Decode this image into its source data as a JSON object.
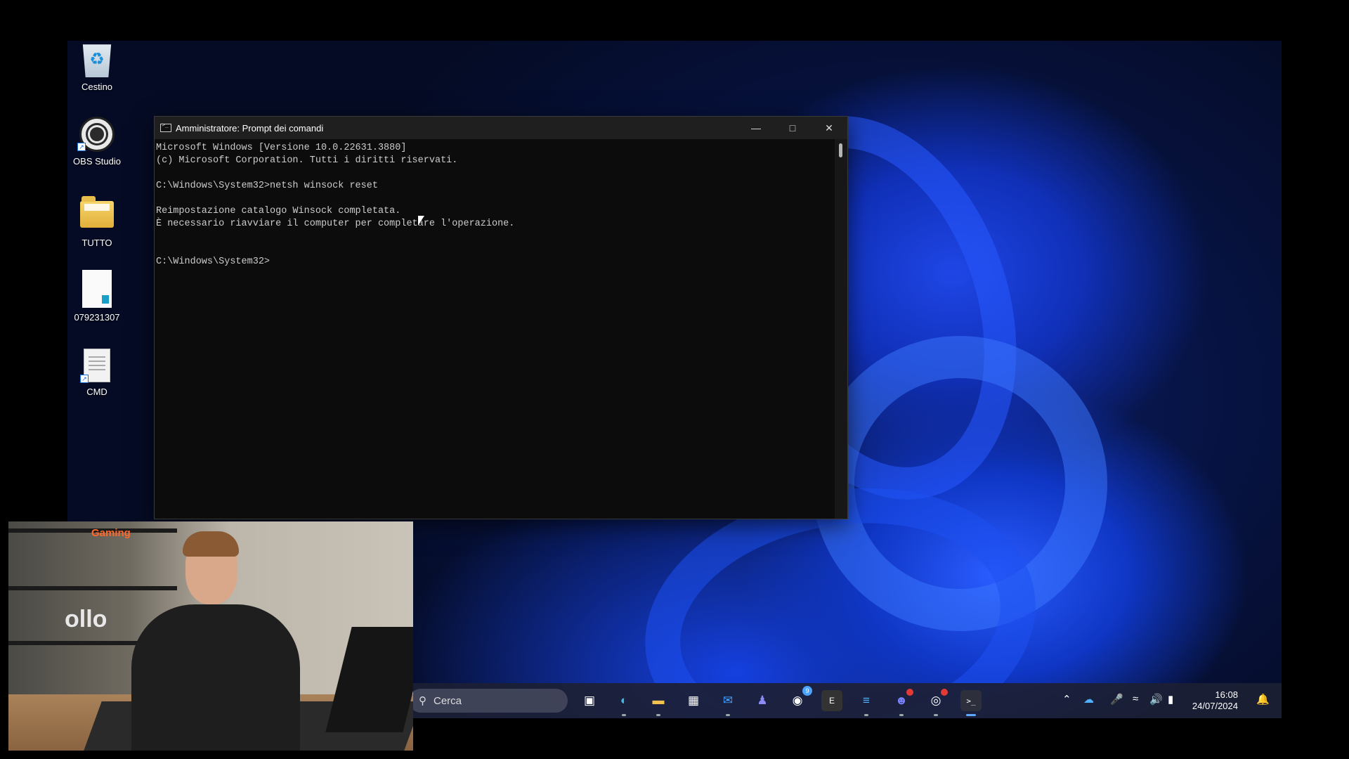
{
  "desktop": {
    "icons": [
      {
        "label": "Cestino",
        "icon": "recycle-bin-icon"
      },
      {
        "label": "OBS Studio",
        "icon": "obs-studio-icon"
      },
      {
        "label": "TUTTO",
        "icon": "folder-icon"
      },
      {
        "label": "079231307",
        "icon": "document-icon"
      },
      {
        "label": "CMD",
        "icon": "text-file-icon"
      }
    ]
  },
  "cmd_window": {
    "title": "Amministratore: Prompt dei comandi",
    "lines": [
      "Microsoft Windows [Versione 10.0.22631.3880]",
      "(c) Microsoft Corporation. Tutti i diritti riservati.",
      "",
      "C:\\Windows\\System32>netsh winsock reset",
      "",
      "Reimpostazione catalogo Winsock completata.",
      "È necessario riavviare il computer per completare l'operazione.",
      "",
      "",
      "C:\\Windows\\System32>"
    ]
  },
  "taskbar": {
    "search_placeholder": "Cerca",
    "apps": [
      {
        "name": "task-view",
        "glyph": "▣"
      },
      {
        "name": "edge",
        "glyph": "◐"
      },
      {
        "name": "file-explorer",
        "glyph": "▬"
      },
      {
        "name": "microsoft-store",
        "glyph": "▦"
      },
      {
        "name": "outlook",
        "glyph": "✉"
      },
      {
        "name": "teams",
        "glyph": "♟"
      },
      {
        "name": "app-notifications",
        "glyph": "◉",
        "badge": "9"
      },
      {
        "name": "epic-games",
        "glyph": "E"
      },
      {
        "name": "notepad",
        "glyph": "≡"
      },
      {
        "name": "discord",
        "glyph": "☻"
      },
      {
        "name": "obs-studio",
        "glyph": "◎"
      },
      {
        "name": "terminal",
        "glyph": ">_"
      }
    ],
    "clock": {
      "time": "16:08",
      "date": "24/07/2024"
    }
  },
  "webcam": {
    "brand_text": "Gaming",
    "logo_text": "ollo"
  },
  "colors": {
    "console_bg": "#0c0c0c",
    "console_text": "#cccccc",
    "titlebar": "#1f1f1f",
    "taskbar": "#1c2034"
  }
}
